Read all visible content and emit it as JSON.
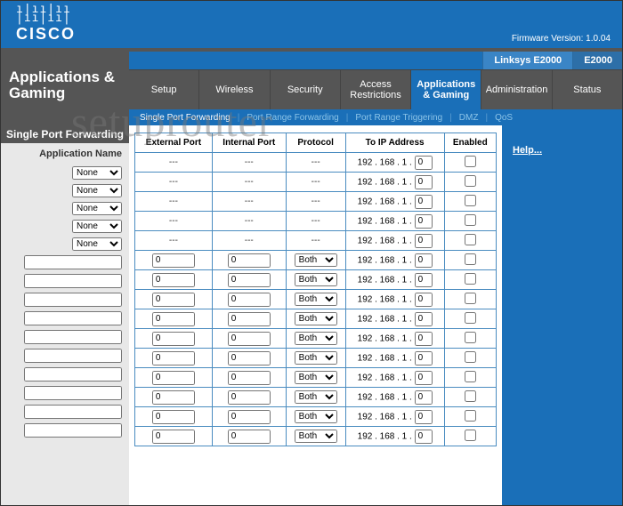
{
  "watermark": "setuprouter",
  "header": {
    "logo_bars1": "ı|ıı|ıı",
    "logo_bars2": "|ıı|ıı|",
    "logo_text": "CISCO",
    "firmware_label": "Firmware Version: 1.0.04",
    "model": "Linksys E2000",
    "model_short": "E2000"
  },
  "title": "Applications & Gaming",
  "nav": {
    "setup": "Setup",
    "wireless": "Wireless",
    "security": "Security",
    "access": "Access Restrictions",
    "apps": "Applications & Gaming",
    "admin": "Administration",
    "status": "Status"
  },
  "subnav": {
    "spf": "Single Port Forwarding",
    "prf": "Port Range Forwarding",
    "prt": "Port Range Triggering",
    "dmz": "DMZ",
    "qos": "QoS"
  },
  "side": {
    "banner": "Single Port Forwarding",
    "label": "Application Name",
    "none": "None"
  },
  "table": {
    "ext": "External Port",
    "int": "Internal Port",
    "proto": "Protocol",
    "toip": "To IP Address",
    "enabled": "Enabled",
    "dash": "---",
    "zero": "0",
    "both": "Both",
    "ip_prefix": "192 . 168 . 1 ."
  },
  "help": "Help..."
}
